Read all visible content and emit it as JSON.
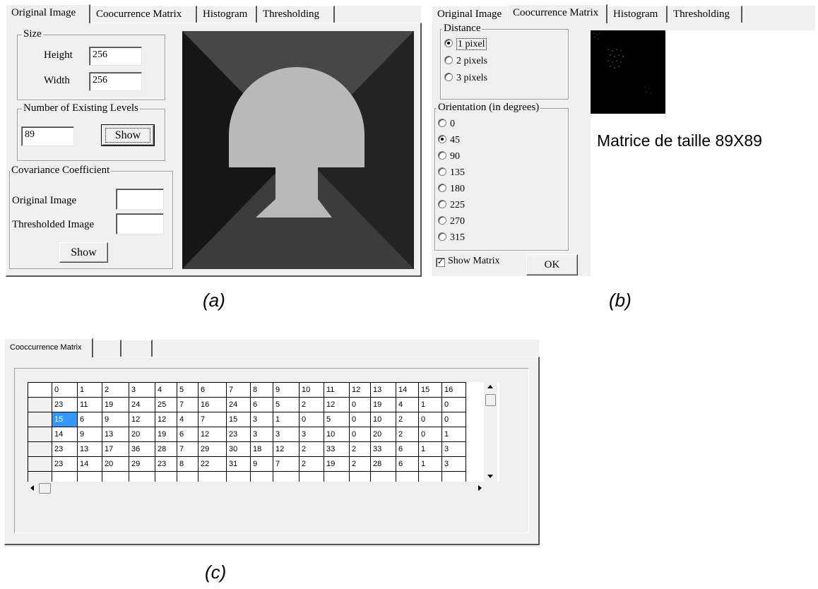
{
  "panel_a": {
    "tabs": [
      "Original Image",
      "Coocurrence Matrix",
      "Histogram",
      "Thresholding"
    ],
    "size_group": {
      "title": "Size",
      "height_label": "Height",
      "height_value": "256",
      "width_label": "Width",
      "width_value": "256"
    },
    "levels_group": {
      "title": "Number of Existing Levels",
      "value": "89",
      "button": "Show"
    },
    "cov_group": {
      "title": "Covariance Coefficient",
      "original_label": "Original  Image",
      "thresholded_label": "Thresholded Image",
      "button": "Show"
    },
    "caption": "(a)"
  },
  "panel_b": {
    "tabs": [
      "Original Image",
      "Coocurrence Matrix",
      "Histogram",
      "Thresholding"
    ],
    "distance": {
      "title": "Distance",
      "options": [
        "1 pixel",
        "2 pixels",
        "3 pixels"
      ],
      "selected": "1 pixel"
    },
    "orientation": {
      "title": "Orientation (in degrees)",
      "options": [
        "0",
        "45",
        "90",
        "135",
        "180",
        "225",
        "270",
        "315"
      ],
      "selected": "45"
    },
    "show_matrix": {
      "label": "Show Matrix",
      "checked": true
    },
    "ok_button": "OK",
    "matrix_caption": "Matrice de taille 89X89",
    "caption": "(b)"
  },
  "panel_c": {
    "tabs": [
      "Cooccurrence Matrix",
      "",
      ""
    ],
    "columns": [
      "0",
      "1",
      "2",
      "3",
      "4",
      "5",
      "6",
      "7",
      "8",
      "9",
      "10",
      "11",
      "12",
      "13",
      "14",
      "15",
      "16"
    ],
    "rows": [
      [
        "23",
        "11",
        "19",
        "24",
        "25",
        "7",
        "16",
        "24",
        "6",
        "5",
        "2",
        "12",
        "0",
        "19",
        "4",
        "1",
        "0"
      ],
      [
        "15",
        "6",
        "9",
        "12",
        "12",
        "4",
        "7",
        "15",
        "3",
        "1",
        "0",
        "5",
        "0",
        "10",
        "2",
        "0",
        "0"
      ],
      [
        "14",
        "9",
        "13",
        "20",
        "19",
        "6",
        "12",
        "23",
        "3",
        "3",
        "3",
        "10",
        "0",
        "20",
        "2",
        "0",
        "1"
      ],
      [
        "23",
        "13",
        "17",
        "36",
        "28",
        "7",
        "29",
        "30",
        "18",
        "12",
        "2",
        "33",
        "2",
        "33",
        "6",
        "1",
        "3"
      ],
      [
        "23",
        "14",
        "20",
        "29",
        "23",
        "8",
        "22",
        "31",
        "9",
        "7",
        "2",
        "19",
        "2",
        "28",
        "6",
        "1",
        "3"
      ]
    ],
    "selected_cell": "15",
    "caption": "(c)"
  }
}
